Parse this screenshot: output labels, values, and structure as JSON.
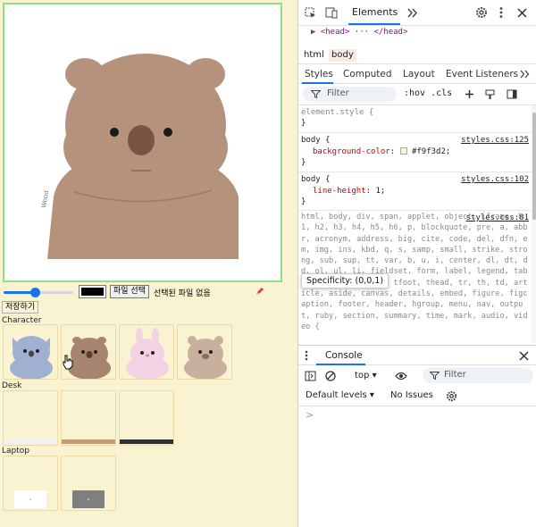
{
  "app": {
    "file_button_label": "파일 선택",
    "file_status": "선택된 파일 없음",
    "save_label": "저장하기",
    "brush_color": "#000000",
    "brush_size_fraction": 0.45,
    "sections": {
      "character": "Character",
      "desk": "Desk",
      "laptop": "Laptop"
    },
    "canvas_signature": "Wood"
  },
  "devtools": {
    "toolbar": {
      "elements_tab": "Elements"
    },
    "dom": {
      "head_line": "<head> ··· </head>"
    },
    "crumbs": [
      "html",
      "body"
    ],
    "subtabs": [
      "Styles",
      "Computed",
      "Layout",
      "Event Listeners"
    ],
    "filter_placeholder": "Filter",
    "hov_cls": ":hov  .cls",
    "rules": {
      "element_style": "element.style {",
      "close": "}",
      "rule1_selector": "body {",
      "rule1_src": "styles.css:125",
      "rule1_prop": "background-color",
      "rule1_val": "#f9f3d2;",
      "rule2_selector": "body {",
      "rule2_src": "styles.css:102",
      "rule2_prop": "line-height",
      "rule2_val": "1;",
      "rule3_src": "styles.css:81",
      "ua_text": "html, body, div, span, applet, object, iframe, h1, h2, h3, h4, h5, h6, p, blockquote, pre, a, abbr, acronym, address, big, cite, code, del, dfn, em, img, ins, kbd, q, s, samp, small, strike, strong, sub, sup, tt, var, b, u, i, center, dl, dt, dd, ol, ul, li, fieldset, form, label, legend, table, caption, tbody, tfoot, thead, tr, th, td, article, aside, canvas, details, embed, figure, figcaption, footer, header, hgroup, menu, nav, output, ruby, section, summary, time, mark, audio, video {"
    },
    "tooltip": "Specificity: (0,0,1)",
    "console": {
      "tab": "Console",
      "context": "top",
      "filter_placeholder": "Filter",
      "levels": "Default levels",
      "issues": "No Issues",
      "prompt": ">"
    }
  }
}
